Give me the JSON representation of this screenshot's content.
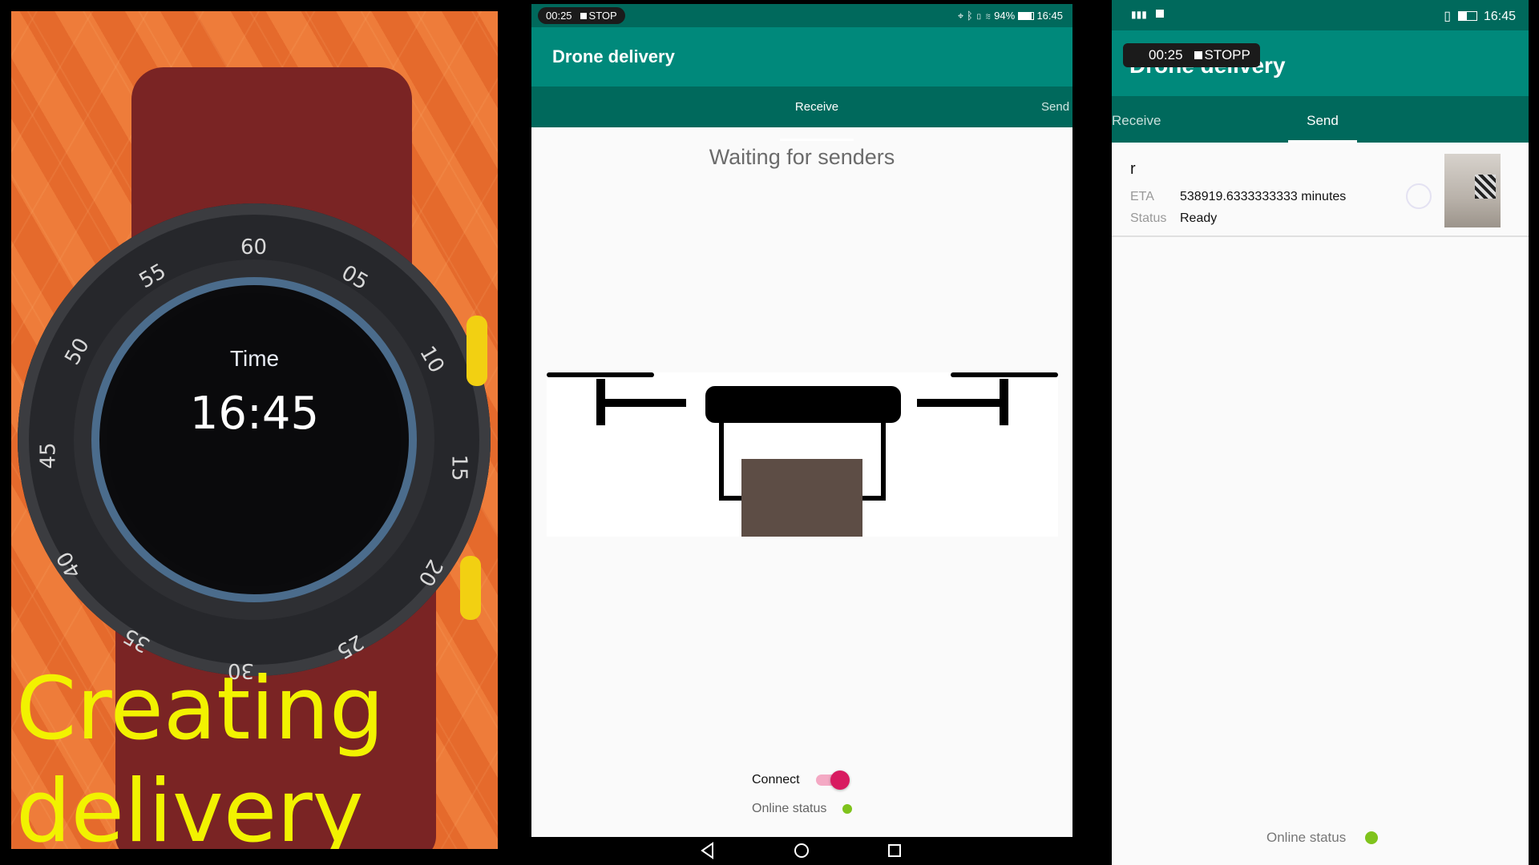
{
  "watch": {
    "time_label": "Time",
    "time_value": "16:45",
    "bezel_numbers": [
      "60",
      "05",
      "10",
      "15",
      "20",
      "25",
      "30",
      "35",
      "40",
      "45",
      "50",
      "55"
    ],
    "crown_color": "#f2d012"
  },
  "caption": {
    "line1": "Creating",
    "line2": "delivery",
    "color": "#f2f200"
  },
  "tablet": {
    "statusbar": {
      "recording_time": "00:25",
      "recording_stop": "STOP",
      "battery": "94%",
      "clock": "16:45"
    },
    "app_title": "Drone delivery",
    "tabs": {
      "receive": "Receive",
      "send": "Send"
    },
    "waiting_text": "Waiting for senders",
    "connect_label": "Connect",
    "connect_on": true,
    "online_status_label": "Online status",
    "colors": {
      "appbar": "#00897b",
      "tabs": "#00695c",
      "toggle": "#d81b60",
      "online": "#7fc31c"
    },
    "nav": {
      "back_icon": "back-triangle-icon",
      "home_icon": "home-circle-icon",
      "recents_icon": "recents-square-icon"
    }
  },
  "phone": {
    "statusbar": {
      "clock": "16:45"
    },
    "recording": {
      "time": "00:25",
      "stop": "STOPP"
    },
    "app_title": "Drone delivery",
    "tabs": {
      "receive": "Receive",
      "send": "Send"
    },
    "delivery": {
      "name": "r",
      "eta_label": "ETA",
      "eta_value": "538919.6333333333 minutes",
      "status_label": "Status",
      "status_value": "Ready"
    },
    "online_status_label": "Online status"
  }
}
